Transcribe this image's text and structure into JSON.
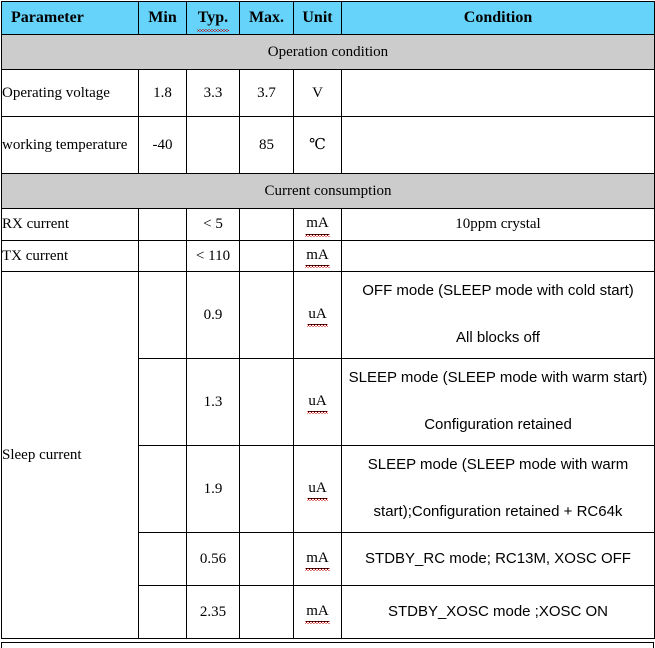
{
  "table": {
    "columns": [
      {
        "key": "parameter",
        "label": "Parameter"
      },
      {
        "key": "min",
        "label": "Min"
      },
      {
        "key": "typ",
        "label": "Typ."
      },
      {
        "key": "max",
        "label": "Max."
      },
      {
        "key": "unit",
        "label": "Unit"
      },
      {
        "key": "condition",
        "label": "Condition"
      }
    ],
    "sections": [
      {
        "id": "operation",
        "title": "Operation condition"
      },
      {
        "id": "current",
        "title": "Current consumption"
      }
    ],
    "rows": {
      "operating_voltage": {
        "parameter": "Operating voltage",
        "min": "1.8",
        "typ": "3.3",
        "max": "3.7",
        "unit": "V",
        "condition": ""
      },
      "working_temperature": {
        "parameter": "working temperature",
        "min": "-40",
        "typ": "",
        "max": "85",
        "unit": "℃",
        "condition": ""
      },
      "rx_current": {
        "parameter": "RX current",
        "min": "",
        "typ": "< 5",
        "max": "",
        "unit": "mA",
        "condition": "10ppm crystal"
      },
      "tx_current": {
        "parameter": "TX current",
        "min": "",
        "typ": "< 110",
        "max": "",
        "unit": "mA",
        "condition": ""
      },
      "sleep_label": "Sleep current",
      "sleep_1": {
        "min": "",
        "typ": "0.9",
        "max": "",
        "unit": "uA",
        "condition_line1": "OFF mode (SLEEP mode with cold start)",
        "condition_line2": "All blocks off"
      },
      "sleep_2": {
        "min": "",
        "typ": "1.3",
        "max": "",
        "unit": "uA",
        "condition_line1": "SLEEP mode (SLEEP mode with warm start)",
        "condition_line2": "Configuration retained"
      },
      "sleep_3": {
        "min": "",
        "typ": "1.9",
        "max": "",
        "unit": "uA",
        "condition_line1": "SLEEP mode (SLEEP mode with warm",
        "condition_line2": "start);Configuration retained + RC64k"
      },
      "sleep_4": {
        "min": "",
        "typ": "0.56",
        "max": "",
        "unit": "mA",
        "condition_line1": "STDBY_RC mode; RC13M, XOSC OFF"
      },
      "sleep_5": {
        "min": "",
        "typ": "2.35",
        "max": "",
        "unit": "mA",
        "condition_line1": "STDBY_XOSC mode ;XOSC ON"
      }
    }
  },
  "colors": {
    "header_background": "#66D4FA",
    "section_background": "#CCCCCC",
    "border": "#000000",
    "text": "#000000",
    "spellcheck_underline": "#C00000",
    "page_background": "#FFFFFF"
  }
}
